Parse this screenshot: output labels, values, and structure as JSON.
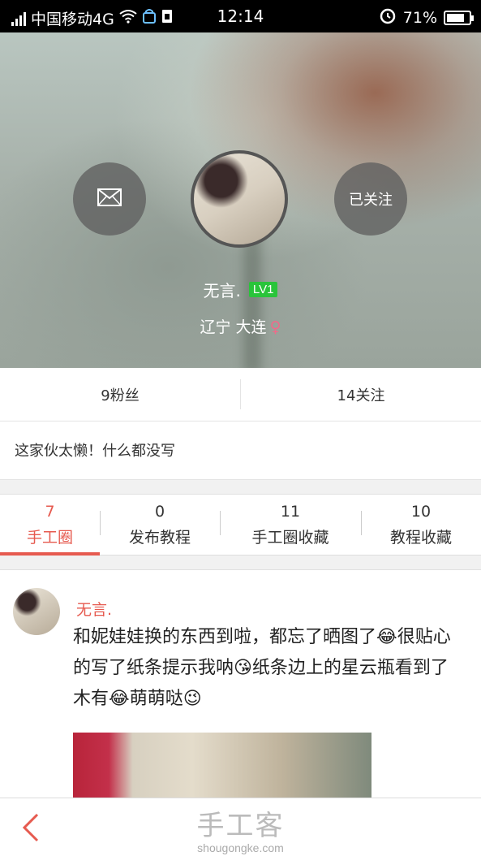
{
  "status_bar": {
    "carrier": "中国移动4G",
    "time": "12:14",
    "battery": "71%"
  },
  "profile": {
    "follow_label": "已关注",
    "username": "无言.",
    "level": "LV1",
    "location": "辽宁 大连",
    "gender_symbol": "♀"
  },
  "stats": {
    "fans": "9粉丝",
    "following": "14关注"
  },
  "bio": "这家伙太懒！什么都没写",
  "tabs": [
    {
      "count": "7",
      "label": "手工圈"
    },
    {
      "count": "0",
      "label": "发布教程"
    },
    {
      "count": "11",
      "label": "手工圈收藏"
    },
    {
      "count": "10",
      "label": "教程收藏"
    }
  ],
  "post": {
    "author": "无言.",
    "text": "和妮娃娃换的东西到啦，都忘了晒图了😂很贴心的写了纸条提示我呐😘纸条边上的星云瓶看到了木有😂萌萌哒😉"
  },
  "brand": {
    "name": "手工客",
    "url": "shougongke.com"
  },
  "colors": {
    "accent": "#e65a4f",
    "level_badge": "#29c43a",
    "gender": "#f06a8a"
  }
}
